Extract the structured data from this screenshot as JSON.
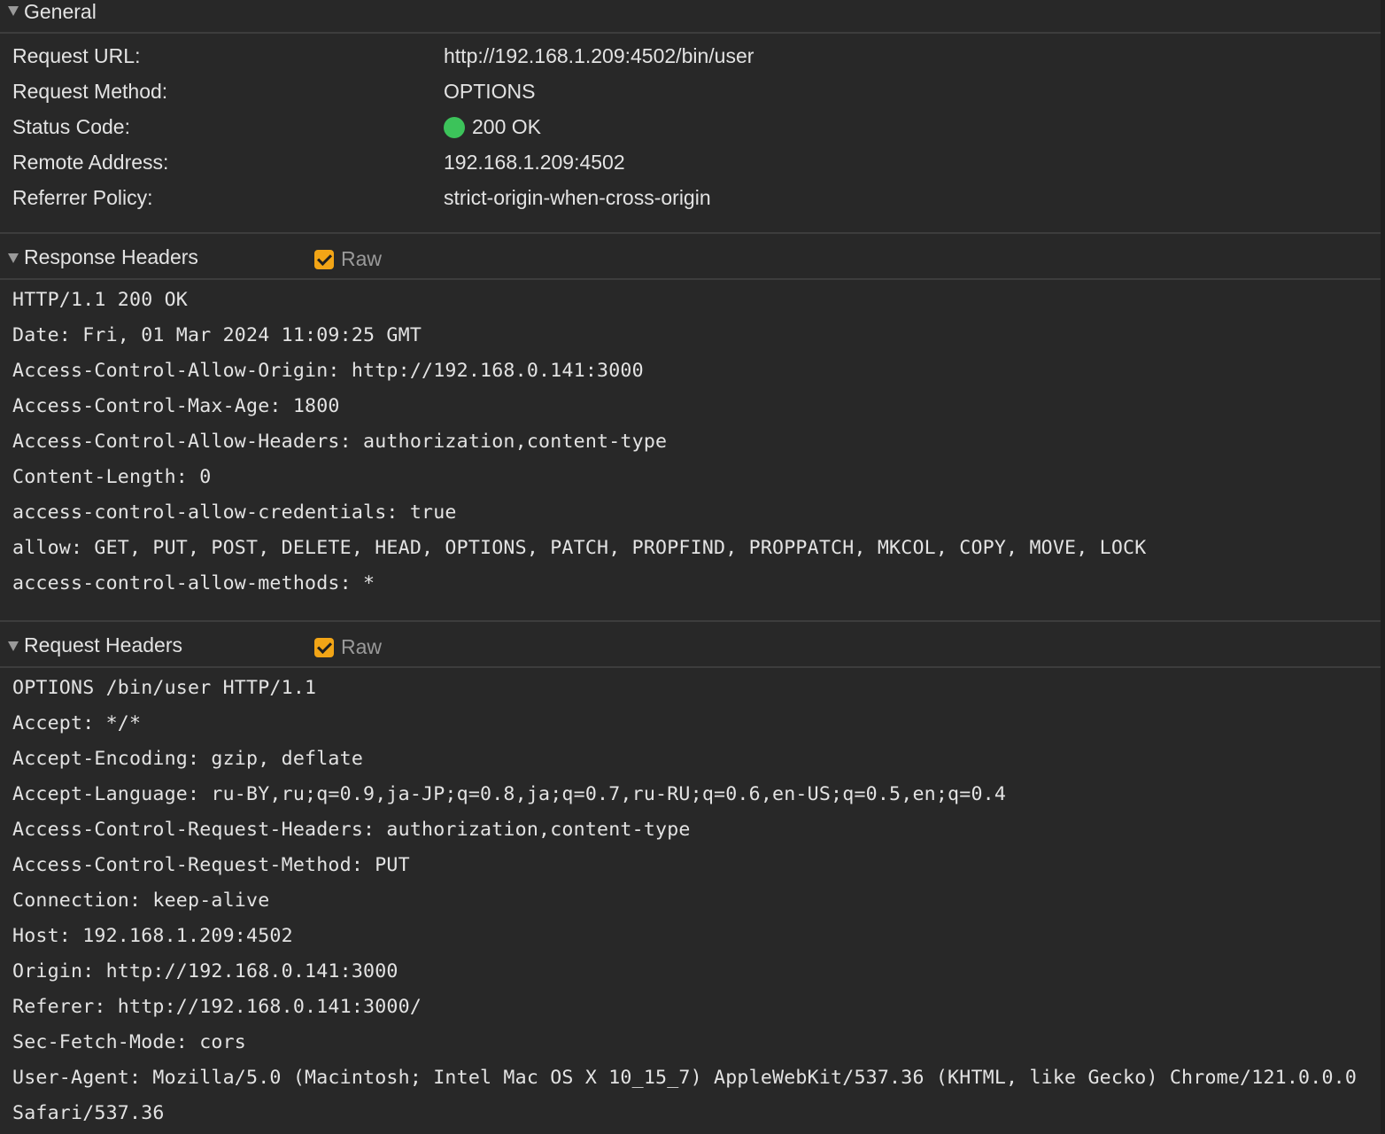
{
  "general": {
    "title": "General",
    "rows": [
      {
        "label": "Request URL:",
        "value": "http://192.168.1.209:4502/bin/user"
      },
      {
        "label": "Request Method:",
        "value": "OPTIONS"
      },
      {
        "label": "Status Code:",
        "value": "200 OK",
        "status_color": "#3cc35a"
      },
      {
        "label": "Remote Address:",
        "value": "192.168.1.209:4502"
      },
      {
        "label": "Referrer Policy:",
        "value": "strict-origin-when-cross-origin"
      }
    ]
  },
  "response_headers": {
    "title": "Response Headers",
    "raw_label": "Raw",
    "raw_checked": true,
    "lines": [
      "HTTP/1.1 200 OK",
      "Date: Fri, 01 Mar 2024 11:09:25 GMT",
      "Access-Control-Allow-Origin: http://192.168.0.141:3000",
      "Access-Control-Max-Age: 1800",
      "Access-Control-Allow-Headers: authorization,content-type",
      "Content-Length: 0",
      "access-control-allow-credentials: true",
      "allow: GET, PUT, POST, DELETE, HEAD, OPTIONS, PATCH, PROPFIND, PROPPATCH, MKCOL, COPY, MOVE, LOCK",
      "access-control-allow-methods: *"
    ]
  },
  "request_headers": {
    "title": "Request Headers",
    "raw_label": "Raw",
    "raw_checked": true,
    "lines": [
      "OPTIONS /bin/user HTTP/1.1",
      "Accept: */*",
      "Accept-Encoding: gzip, deflate",
      "Accept-Language: ru-BY,ru;q=0.9,ja-JP;q=0.8,ja;q=0.7,ru-RU;q=0.6,en-US;q=0.5,en;q=0.4",
      "Access-Control-Request-Headers: authorization,content-type",
      "Access-Control-Request-Method: PUT",
      "Connection: keep-alive",
      "Host: 192.168.1.209:4502",
      "Origin: http://192.168.0.141:3000",
      "Referer: http://192.168.0.141:3000/",
      "Sec-Fetch-Mode: cors",
      "User-Agent: Mozilla/5.0 (Macintosh; Intel Mac OS X 10_15_7) AppleWebKit/537.36 (KHTML, like Gecko) Chrome/121.0.0.0",
      "Safari/537.36"
    ]
  },
  "colors": {
    "background": "#282828",
    "text": "#e3e3e3",
    "muted": "#9a9a9a",
    "checkbox_accent": "#f2a516",
    "divider": "#3d3d3d"
  }
}
